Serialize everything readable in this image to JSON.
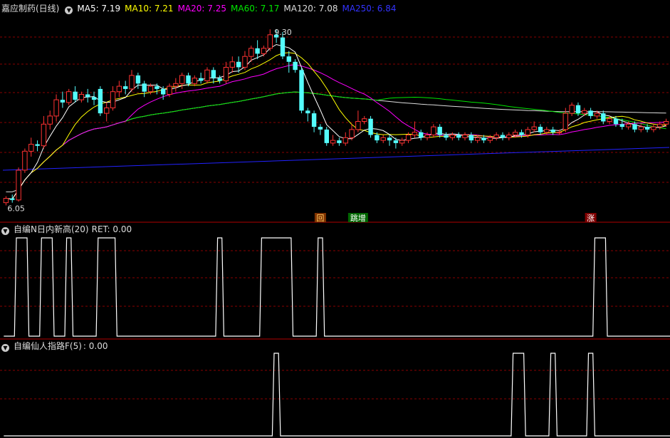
{
  "colors": {
    "up": "#ff3232",
    "down": "#54fcfc",
    "ma5": "#ffffff",
    "ma10": "#ffff00",
    "ma20": "#ff00ff",
    "ma60": "#00e600",
    "ma120": "#dddddd",
    "ma250": "#2222ff",
    "grid": "#8a0000",
    "divider": "#b00000"
  },
  "header": {
    "title": "嘉应制药(日线)",
    "ma5": "MA5: 7.19",
    "ma10": "MA10: 7.21",
    "ma20": "MA20: 7.25",
    "ma60": "MA60: 7.17",
    "ma120": "MA120: 7.08",
    "ma250": "MA250: 6.84"
  },
  "chart_data": [
    {
      "type": "candlestick",
      "title": "嘉应制药(日线)",
      "annotations": {
        "high_label": "9.30",
        "low_label": "6.05"
      },
      "ylim": [
        5.95,
        9.5
      ],
      "candles": [
        [
          6.1,
          6.18,
          6.05,
          6.22
        ],
        [
          6.18,
          6.15,
          6.1,
          6.25
        ],
        [
          6.15,
          6.7,
          6.12,
          6.75
        ],
        [
          6.7,
          7.05,
          6.65,
          7.1
        ],
        [
          7.05,
          7.18,
          6.95,
          7.3
        ],
        [
          7.18,
          7.15,
          7.05,
          7.25
        ],
        [
          7.15,
          7.55,
          7.1,
          7.7
        ],
        [
          7.55,
          7.7,
          7.45,
          7.8
        ],
        [
          7.7,
          8.0,
          7.6,
          8.1
        ],
        [
          8.0,
          7.95,
          7.85,
          8.15
        ],
        [
          7.95,
          8.15,
          7.9,
          8.2
        ],
        [
          8.15,
          8.0,
          7.95,
          8.25
        ],
        [
          8.0,
          8.1,
          7.95,
          8.15
        ],
        [
          8.1,
          8.05,
          7.95,
          8.2
        ],
        [
          8.05,
          8.0,
          7.9,
          8.15
        ],
        [
          8.2,
          7.75,
          7.7,
          8.25
        ],
        [
          7.75,
          7.85,
          7.6,
          7.95
        ],
        [
          7.85,
          8.15,
          7.8,
          8.25
        ],
        [
          8.15,
          8.25,
          8.05,
          8.35
        ],
        [
          8.25,
          8.2,
          8.1,
          8.35
        ],
        [
          8.2,
          8.45,
          8.15,
          8.55
        ],
        [
          8.45,
          8.3,
          8.2,
          8.5
        ],
        [
          8.3,
          8.15,
          8.05,
          8.35
        ],
        [
          8.15,
          8.25,
          8.1,
          8.3
        ],
        [
          8.25,
          8.2,
          8.1,
          8.3
        ],
        [
          8.2,
          8.1,
          8.0,
          8.25
        ],
        [
          8.1,
          8.25,
          8.05,
          8.3
        ],
        [
          8.25,
          8.3,
          8.15,
          8.4
        ],
        [
          8.3,
          8.45,
          8.2,
          8.5
        ],
        [
          8.45,
          8.3,
          8.25,
          8.5
        ],
        [
          8.3,
          8.4,
          8.25,
          8.45
        ],
        [
          8.4,
          8.35,
          8.3,
          8.5
        ],
        [
          8.35,
          8.55,
          8.3,
          8.6
        ],
        [
          8.55,
          8.4,
          8.3,
          8.6
        ],
        [
          8.4,
          8.35,
          8.3,
          8.45
        ],
        [
          8.35,
          8.6,
          8.3,
          8.7
        ],
        [
          8.6,
          8.7,
          8.5,
          8.8
        ],
        [
          8.7,
          8.6,
          8.5,
          8.8
        ],
        [
          8.6,
          8.8,
          8.55,
          8.9
        ],
        [
          8.8,
          8.95,
          8.7,
          9.0
        ],
        [
          8.95,
          8.85,
          8.75,
          9.1
        ],
        [
          8.85,
          8.95,
          8.8,
          9.0
        ],
        [
          8.95,
          9.2,
          8.9,
          9.3
        ],
        [
          9.2,
          9.15,
          9.05,
          9.3
        ],
        [
          9.15,
          8.8,
          8.75,
          9.25
        ],
        [
          8.8,
          8.7,
          8.5,
          8.9
        ],
        [
          8.7,
          8.55,
          8.5,
          8.75
        ],
        [
          8.55,
          7.8,
          7.75,
          8.6
        ],
        [
          7.8,
          7.75,
          7.6,
          7.85
        ],
        [
          7.75,
          7.5,
          7.4,
          7.8
        ],
        [
          7.5,
          7.45,
          7.35,
          7.55
        ],
        [
          7.45,
          7.2,
          7.15,
          7.5
        ],
        [
          7.2,
          7.25,
          7.15,
          7.35
        ],
        [
          7.25,
          7.2,
          7.15,
          7.3
        ],
        [
          7.2,
          7.3,
          7.15,
          7.4
        ],
        [
          7.3,
          7.45,
          7.25,
          7.55
        ],
        [
          7.45,
          7.6,
          7.4,
          7.8
        ],
        [
          7.6,
          7.65,
          7.55,
          7.7
        ],
        [
          7.65,
          7.35,
          7.3,
          7.7
        ],
        [
          7.35,
          7.25,
          7.2,
          7.4
        ],
        [
          7.25,
          7.3,
          7.2,
          7.35
        ],
        [
          7.3,
          7.25,
          7.15,
          7.35
        ],
        [
          7.25,
          7.2,
          7.1,
          7.3
        ],
        [
          7.2,
          7.25,
          7.15,
          7.3
        ],
        [
          7.25,
          7.35,
          7.2,
          7.4
        ],
        [
          7.35,
          7.4,
          7.3,
          7.6
        ],
        [
          7.4,
          7.3,
          7.25,
          7.45
        ],
        [
          7.3,
          7.35,
          7.25,
          7.4
        ],
        [
          7.35,
          7.5,
          7.3,
          7.55
        ],
        [
          7.5,
          7.35,
          7.3,
          7.55
        ],
        [
          7.35,
          7.3,
          7.25,
          7.4
        ],
        [
          7.3,
          7.35,
          7.25,
          7.4
        ],
        [
          7.35,
          7.3,
          7.25,
          7.4
        ],
        [
          7.3,
          7.35,
          7.25,
          7.4
        ],
        [
          7.35,
          7.25,
          7.2,
          7.4
        ],
        [
          7.25,
          7.3,
          7.2,
          7.35
        ],
        [
          7.3,
          7.25,
          7.2,
          7.35
        ],
        [
          7.25,
          7.3,
          7.2,
          7.35
        ],
        [
          7.3,
          7.35,
          7.25,
          7.4
        ],
        [
          7.35,
          7.3,
          7.25,
          7.4
        ],
        [
          7.3,
          7.35,
          7.25,
          7.4
        ],
        [
          7.35,
          7.4,
          7.3,
          7.45
        ],
        [
          7.4,
          7.35,
          7.3,
          7.45
        ],
        [
          7.35,
          7.45,
          7.3,
          7.5
        ],
        [
          7.45,
          7.5,
          7.4,
          7.6
        ],
        [
          7.5,
          7.4,
          7.35,
          7.55
        ],
        [
          7.4,
          7.45,
          7.35,
          7.5
        ],
        [
          7.45,
          7.4,
          7.35,
          7.5
        ],
        [
          7.4,
          7.4,
          7.35,
          7.45
        ],
        [
          7.45,
          7.75,
          7.4,
          7.85
        ],
        [
          7.75,
          7.9,
          7.7,
          7.95
        ],
        [
          7.9,
          7.75,
          7.7,
          7.95
        ],
        [
          7.75,
          7.8,
          7.7,
          7.85
        ],
        [
          7.8,
          7.7,
          7.65,
          7.85
        ],
        [
          7.7,
          7.75,
          7.65,
          7.8
        ],
        [
          7.75,
          7.6,
          7.55,
          7.8
        ],
        [
          7.6,
          7.65,
          7.55,
          7.7
        ],
        [
          7.65,
          7.55,
          7.5,
          7.7
        ],
        [
          7.55,
          7.5,
          7.45,
          7.65
        ],
        [
          7.5,
          7.55,
          7.45,
          7.6
        ],
        [
          7.55,
          7.45,
          7.4,
          7.6
        ],
        [
          7.45,
          7.5,
          7.4,
          7.55
        ],
        [
          7.5,
          7.45,
          7.4,
          7.55
        ],
        [
          7.45,
          7.5,
          7.4,
          7.55
        ],
        [
          7.5,
          7.55,
          7.45,
          7.6
        ],
        [
          7.55,
          7.6,
          7.5,
          7.65
        ]
      ],
      "markers": [
        {
          "label": "回",
          "index": 50,
          "color": "#ffcc66",
          "bg": "#803300"
        },
        {
          "label": "跳增",
          "index": 56,
          "color": "#ffffff",
          "bg": "#006600"
        },
        {
          "label": "涨",
          "index": 93,
          "color": "#ffffff",
          "bg": "#800000"
        }
      ]
    },
    {
      "type": "line",
      "title": "自编N日内新高(20)",
      "value_label": "RET: 0.00",
      "ylim": [
        0,
        1
      ],
      "values": [
        0,
        0,
        1,
        1,
        0,
        0,
        1,
        1,
        0,
        0,
        1,
        0,
        0,
        0,
        0,
        1,
        1,
        1,
        0,
        0,
        0,
        0,
        0,
        0,
        0,
        0,
        0,
        0,
        0,
        0,
        0,
        0,
        0,
        0,
        1,
        0,
        0,
        0,
        0,
        0,
        0,
        1,
        1,
        1,
        1,
        1,
        0,
        0,
        0,
        0,
        1,
        0,
        0,
        0,
        0,
        0,
        0,
        0,
        0,
        0,
        0,
        0,
        0,
        0,
        0,
        0,
        0,
        0,
        0,
        0,
        0,
        0,
        0,
        0,
        0,
        0,
        0,
        0,
        0,
        0,
        0,
        0,
        0,
        0,
        0,
        0,
        0,
        0,
        0,
        0,
        0,
        0,
        0,
        0,
        1,
        1,
        0,
        0,
        0,
        0,
        0,
        0,
        0,
        0,
        0,
        0,
        0,
        0,
        0,
        0,
        0
      ]
    },
    {
      "type": "line",
      "title": "自编仙人指路F(5)",
      "value_label": ": 0.00",
      "ylim": [
        0,
        1
      ],
      "values": [
        0,
        0,
        0,
        0,
        0,
        0,
        0,
        0,
        0,
        0,
        0,
        0,
        0,
        0,
        0,
        0,
        0,
        0,
        0,
        0,
        0,
        0,
        0,
        0,
        0,
        0,
        0,
        0,
        0,
        0,
        0,
        0,
        0,
        0,
        0,
        0,
        0,
        0,
        0,
        0,
        0,
        0,
        0,
        1,
        0,
        0,
        0,
        0,
        0,
        0,
        0,
        0,
        0,
        0,
        0,
        0,
        0,
        0,
        0,
        0,
        0,
        0,
        0,
        0,
        0,
        0,
        0,
        0,
        0,
        0,
        0,
        0,
        0,
        0,
        0,
        0,
        0,
        0,
        0,
        0,
        0,
        1,
        1,
        0,
        0,
        0,
        0,
        1,
        0,
        0,
        0,
        0,
        0,
        1,
        0,
        0,
        0,
        0,
        0,
        0,
        0,
        0,
        0,
        0,
        0,
        0,
        0,
        0,
        0,
        0,
        0
      ]
    }
  ],
  "panels": {
    "sub1": {
      "title": "自编N日内新高(20)",
      "value": "RET: 0.00"
    },
    "sub2": {
      "title": "自编仙人指路F(5)",
      "value": ": 0.00"
    }
  }
}
